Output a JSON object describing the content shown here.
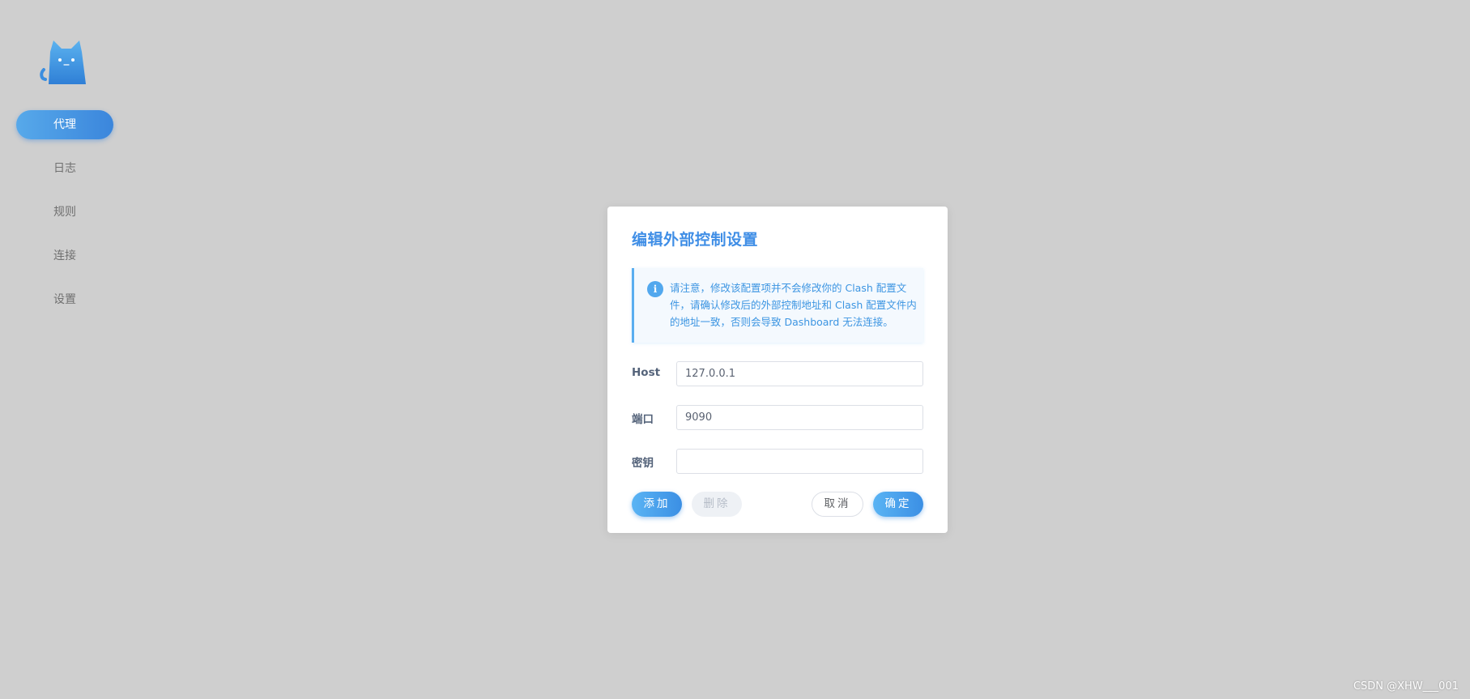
{
  "sidebar": {
    "items": [
      {
        "label": "代理",
        "active": true
      },
      {
        "label": "日志",
        "active": false
      },
      {
        "label": "规则",
        "active": false
      },
      {
        "label": "连接",
        "active": false
      },
      {
        "label": "设置",
        "active": false
      }
    ]
  },
  "dialog": {
    "title": "编辑外部控制设置",
    "alert": {
      "icon": "info-icon",
      "text": "请注意，修改该配置项并不会修改你的 Clash 配置文件，请确认修改后的外部控制地址和 Clash 配置文件内的地址一致，否则会导致 Dashboard 无法连接。"
    },
    "fields": {
      "host": {
        "label": "Host",
        "value": "127.0.0.1"
      },
      "port": {
        "label": "端口",
        "value": "9090"
      },
      "secret": {
        "label": "密钥",
        "value": ""
      }
    },
    "buttons": {
      "add": "添加",
      "delete": "删除",
      "cancel": "取消",
      "confirm": "确定"
    }
  },
  "colors": {
    "accent": "#3b8fe4",
    "background": "#cfcfcf"
  },
  "watermark": "CSDN @XHW___001"
}
